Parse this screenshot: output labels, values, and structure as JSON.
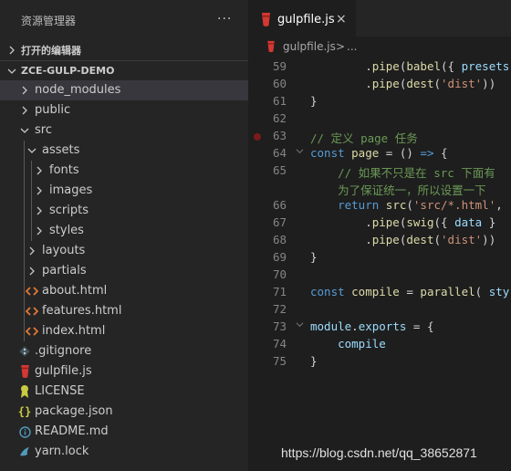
{
  "explorer": {
    "title": "资源管理器",
    "more_glyph": "···",
    "open_editors_label": "打开的编辑器",
    "root_label": "ZCE-GULP-DEMO"
  },
  "tree": [
    {
      "name": "node_modules",
      "kind": "folder",
      "open": false,
      "icon": "chevron-right-icon",
      "selected": true
    },
    {
      "name": "public",
      "kind": "folder",
      "open": false,
      "icon": "chevron-right-icon"
    },
    {
      "name": "src",
      "kind": "folder",
      "open": true,
      "icon": "chevron-down-icon"
    },
    {
      "name": "assets",
      "kind": "folder",
      "open": true,
      "icon": "chevron-down-icon"
    },
    {
      "name": "fonts",
      "kind": "folder",
      "open": false,
      "icon": "chevron-right-icon"
    },
    {
      "name": "images",
      "kind": "folder",
      "open": false,
      "icon": "chevron-right-icon"
    },
    {
      "name": "scripts",
      "kind": "folder",
      "open": false,
      "icon": "chevron-right-icon"
    },
    {
      "name": "styles",
      "kind": "folder",
      "open": false,
      "icon": "chevron-right-icon"
    },
    {
      "name": "layouts",
      "kind": "folder",
      "open": false,
      "icon": "chevron-right-icon"
    },
    {
      "name": "partials",
      "kind": "folder",
      "open": false,
      "icon": "chevron-right-icon"
    },
    {
      "name": "about.html",
      "kind": "file",
      "icon": "html-file-icon"
    },
    {
      "name": "features.html",
      "kind": "file",
      "icon": "html-file-icon"
    },
    {
      "name": "index.html",
      "kind": "file",
      "icon": "html-file-icon"
    },
    {
      "name": ".gitignore",
      "kind": "file",
      "icon": "git-file-icon"
    },
    {
      "name": "gulpfile.js",
      "kind": "file",
      "icon": "gulp-file-icon"
    },
    {
      "name": "LICENSE",
      "kind": "file",
      "icon": "license-file-icon"
    },
    {
      "name": "package.json",
      "kind": "file",
      "icon": "json-file-icon"
    },
    {
      "name": "README.md",
      "kind": "file",
      "icon": "info-file-icon"
    },
    {
      "name": "yarn.lock",
      "kind": "file",
      "icon": "yarn-file-icon"
    }
  ],
  "tab": {
    "label": "gulpfile.js",
    "close_glyph": "×"
  },
  "breadcrumb": {
    "file": "gulpfile.js",
    "separator": ">",
    "ellipsis": "..."
  },
  "code_lines": [
    {
      "n": "59",
      "tokens": [
        [
          "op",
          "        ."
        ],
        [
          "fn",
          "pipe"
        ],
        [
          "op",
          "("
        ],
        [
          "fn",
          "babel"
        ],
        [
          "op",
          "({ "
        ],
        [
          "var",
          "presets"
        ]
      ]
    },
    {
      "n": "60",
      "tokens": [
        [
          "op",
          "        ."
        ],
        [
          "fn",
          "pipe"
        ],
        [
          "op",
          "("
        ],
        [
          "fn",
          "dest"
        ],
        [
          "op",
          "("
        ],
        [
          "str",
          "'dist'"
        ],
        [
          "op",
          "))"
        ]
      ]
    },
    {
      "n": "61",
      "tokens": [
        [
          "op",
          "}"
        ]
      ]
    },
    {
      "n": "62",
      "tokens": []
    },
    {
      "n": "63",
      "breakpoint": true,
      "tokens": [
        [
          "cm",
          "// 定义 page 任务"
        ]
      ]
    },
    {
      "n": "64",
      "fold": true,
      "tokens": [
        [
          "kw",
          "const "
        ],
        [
          "fn",
          "page"
        ],
        [
          "op",
          " = () "
        ],
        [
          "kw",
          "=>"
        ],
        [
          "op",
          " {"
        ]
      ]
    },
    {
      "n": "65",
      "tokens": [
        [
          "cm",
          "    // 如果不只是在 src 下面有"
        ]
      ]
    },
    {
      "n": "",
      "tokens": [
        [
          "cm",
          "    为了保证统一，所以设置一下"
        ]
      ]
    },
    {
      "n": "66",
      "tokens": [
        [
          "op",
          "    "
        ],
        [
          "kw",
          "return "
        ],
        [
          "fn",
          "src"
        ],
        [
          "op",
          "("
        ],
        [
          "str",
          "'src/*.html'"
        ],
        [
          "op",
          ","
        ]
      ]
    },
    {
      "n": "67",
      "tokens": [
        [
          "op",
          "        ."
        ],
        [
          "fn",
          "pipe"
        ],
        [
          "op",
          "("
        ],
        [
          "fn",
          "swig"
        ],
        [
          "op",
          "({ "
        ],
        [
          "var",
          "data"
        ],
        [
          "op",
          " }"
        ]
      ]
    },
    {
      "n": "68",
      "tokens": [
        [
          "op",
          "        ."
        ],
        [
          "fn",
          "pipe"
        ],
        [
          "op",
          "("
        ],
        [
          "fn",
          "dest"
        ],
        [
          "op",
          "("
        ],
        [
          "str",
          "'dist'"
        ],
        [
          "op",
          "))"
        ]
      ]
    },
    {
      "n": "69",
      "tokens": [
        [
          "op",
          "}"
        ]
      ]
    },
    {
      "n": "70",
      "tokens": []
    },
    {
      "n": "71",
      "tokens": [
        [
          "kw",
          "const "
        ],
        [
          "fn",
          "compile"
        ],
        [
          "op",
          " = "
        ],
        [
          "fn",
          "parallel"
        ],
        [
          "op",
          "( "
        ],
        [
          "var",
          "sty"
        ]
      ]
    },
    {
      "n": "72",
      "tokens": []
    },
    {
      "n": "73",
      "fold": true,
      "tokens": [
        [
          "var",
          "module"
        ],
        [
          "op",
          "."
        ],
        [
          "var",
          "exports"
        ],
        [
          "op",
          " = {"
        ]
      ]
    },
    {
      "n": "74",
      "tokens": [
        [
          "op",
          "    "
        ],
        [
          "var",
          "compile"
        ]
      ]
    },
    {
      "n": "75",
      "tokens": [
        [
          "op",
          "}"
        ]
      ]
    }
  ],
  "watermark": "https://blog.csdn.net/qq_38652871"
}
